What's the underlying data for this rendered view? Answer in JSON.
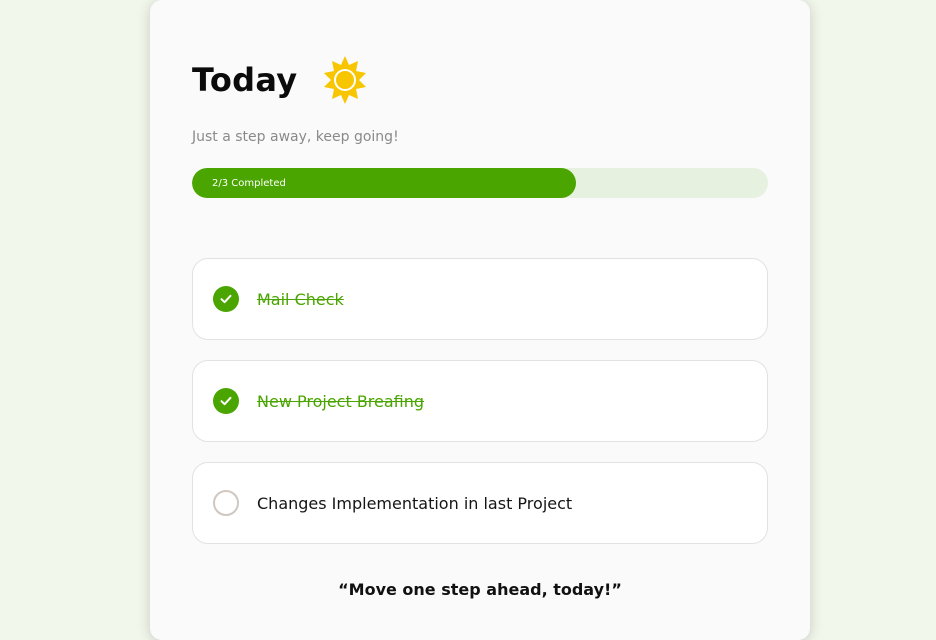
{
  "header": {
    "title": "Today",
    "icon": "sun-icon",
    "icon_color": "#f7c600"
  },
  "subtitle": "Just a step away, keep going!",
  "progress": {
    "label": "2/3 Completed",
    "completed": 2,
    "total": 3,
    "fill_color": "#4aa500",
    "track_color": "#e7f1df"
  },
  "tasks": [
    {
      "label": "Mail Check",
      "done": true
    },
    {
      "label": "New Project Breafing",
      "done": true
    },
    {
      "label": "Changes Implementation in last Project",
      "done": false
    }
  ],
  "quote": "“Move one step ahead, today!”",
  "colors": {
    "accent": "#4aa500",
    "background": "#f2f7ec"
  }
}
